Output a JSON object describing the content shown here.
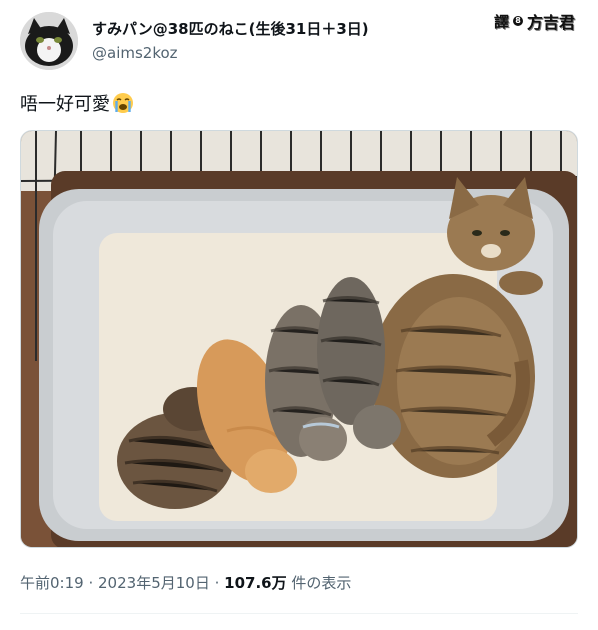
{
  "user": {
    "display_name": "すみパン@38匹のねこ(生後31日＋3日)",
    "handle": "@aims2koz"
  },
  "watermark": {
    "prefix": "譯",
    "dot": "8",
    "suffix": "方吉君"
  },
  "tweet": {
    "text": "唔一好可愛",
    "emoji": "loudly-crying-face"
  },
  "meta": {
    "time": "午前0:19",
    "date": "2023年5月10日",
    "views_count": "107.6万",
    "views_label": "件の表示"
  },
  "colors": {
    "text": "#0f1419",
    "secondary": "#536471",
    "border": "#cfd9de"
  }
}
